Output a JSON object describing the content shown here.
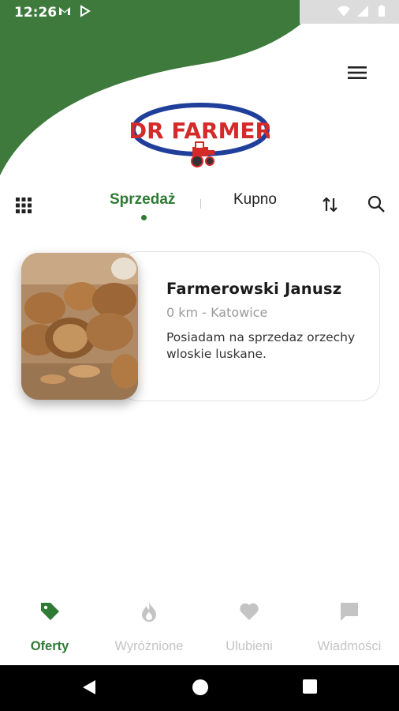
{
  "status_bar": {
    "time": "12:26",
    "left_icons": [
      "gmail-icon",
      "play-store-icon"
    ],
    "right_icons": [
      "wifi-icon",
      "signal-icon",
      "battery-icon"
    ]
  },
  "header": {
    "logo_text": "DR FARMER",
    "menu_icon": "hamburger-menu-icon"
  },
  "tabs": {
    "items": [
      {
        "label": "Sprzedaż",
        "active": true
      },
      {
        "label": "Kupno",
        "active": false
      }
    ],
    "left_icon": "grid-icon",
    "right_icons": [
      "sort-icon",
      "search-icon"
    ]
  },
  "offers": [
    {
      "name": "Farmerowski Janusz",
      "location": "0 km - Katowice",
      "description": "Posiadam na sprzedaz orzechy wloskie luskane.",
      "image": "walnuts-photo"
    }
  ],
  "bottom_nav": {
    "items": [
      {
        "label": "Oferty",
        "icon": "tag-icon",
        "active": true
      },
      {
        "label": "Wyróżnione",
        "icon": "flame-icon",
        "active": false
      },
      {
        "label": "Ulubieni",
        "icon": "heart-icon",
        "active": false
      },
      {
        "label": "Wiadmości",
        "icon": "chat-icon",
        "active": false
      }
    ]
  },
  "colors": {
    "brand_green": "#2f7a34",
    "header_green": "#3d7a3c",
    "logo_red": "#d42a2a",
    "logo_blue": "#1f3f9a",
    "inactive_gray": "#c4c4c4"
  }
}
